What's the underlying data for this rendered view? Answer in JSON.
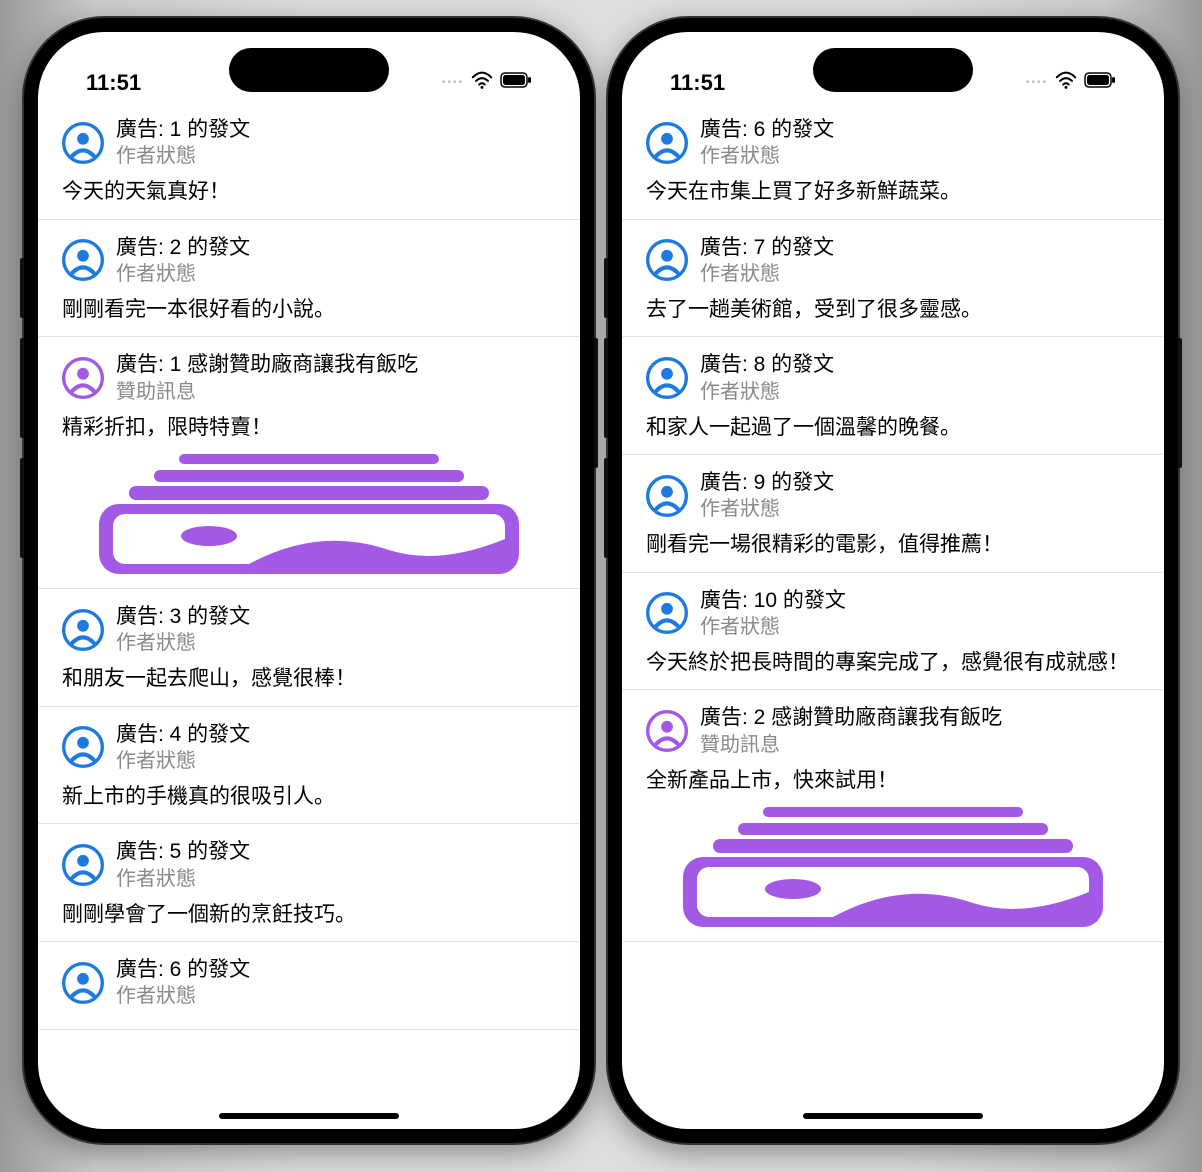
{
  "status": {
    "time": "11:51"
  },
  "colors": {
    "post": "#1f7ae0",
    "sponsor": "#a259e6"
  },
  "subtitles": {
    "author_status": "作者狀態",
    "sponsor_msg": "贊助訊息"
  },
  "phone1": {
    "cells": [
      {
        "kind": "post",
        "title": "廣告: 1 的發文",
        "subtitle": "作者狀態",
        "body": "今天的天氣真好！"
      },
      {
        "kind": "post",
        "title": "廣告: 2 的發文",
        "subtitle": "作者狀態",
        "body": "剛剛看完一本很好看的小說。"
      },
      {
        "kind": "sponsor",
        "title": "廣告: 1 感謝贊助廠商讓我有飯吃",
        "subtitle": "贊助訊息",
        "body": "精彩折扣，限時特賣！",
        "image": true
      },
      {
        "kind": "post",
        "title": "廣告: 3 的發文",
        "subtitle": "作者狀態",
        "body": "和朋友一起去爬山，感覺很棒！"
      },
      {
        "kind": "post",
        "title": "廣告: 4 的發文",
        "subtitle": "作者狀態",
        "body": "新上市的手機真的很吸引人。"
      },
      {
        "kind": "post",
        "title": "廣告: 5 的發文",
        "subtitle": "作者狀態",
        "body": "剛剛學會了一個新的烹飪技巧。"
      },
      {
        "kind": "post",
        "title": "廣告: 6 的發文",
        "subtitle": "作者狀態",
        "body": "",
        "partial": true
      }
    ]
  },
  "phone2": {
    "cells": [
      {
        "kind": "post",
        "title": "廣告: 6 的發文",
        "subtitle": "作者狀態",
        "body": "今天在市集上買了好多新鮮蔬菜。"
      },
      {
        "kind": "post",
        "title": "廣告: 7 的發文",
        "subtitle": "作者狀態",
        "body": "去了一趟美術館，受到了很多靈感。"
      },
      {
        "kind": "post",
        "title": "廣告: 8 的發文",
        "subtitle": "作者狀態",
        "body": "和家人一起過了一個溫馨的晚餐。"
      },
      {
        "kind": "post",
        "title": "廣告: 9 的發文",
        "subtitle": "作者狀態",
        "body": "剛看完一場很精彩的電影，值得推薦！"
      },
      {
        "kind": "post",
        "title": "廣告: 10 的發文",
        "subtitle": "作者狀態",
        "body": "今天終於把長時間的專案完成了，感覺很有成就感！"
      },
      {
        "kind": "sponsor",
        "title": "廣告: 2 感謝贊助廠商讓我有飯吃",
        "subtitle": "贊助訊息",
        "body": "全新產品上市，快來試用！",
        "image": true
      }
    ]
  }
}
